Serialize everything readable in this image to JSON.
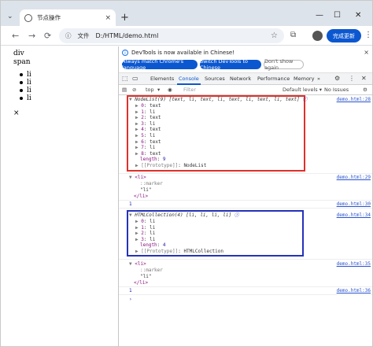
{
  "browser": {
    "tab_title": "节点操作",
    "tab_close": "×",
    "new_tab": "+",
    "tab_menu": "⌄",
    "win_min": "—",
    "win_max": "☐",
    "win_close": "✕",
    "back": "←",
    "forward": "→",
    "reload": "⟳",
    "site_info": "ⓘ",
    "file_chip": "文件",
    "url": "D:/HTML/demo.html",
    "star": "☆",
    "ext": "⧉",
    "avatar": "●",
    "finish_update": "完成更新",
    "kebab": "⋮"
  },
  "page": {
    "div_text": "div",
    "span_text": "span",
    "items": [
      "li",
      "li",
      "li",
      "li"
    ],
    "x_text": "×"
  },
  "devtools": {
    "info_message": "DevTools is now available in Chinese!",
    "btn_match": "Always match Chrome's language",
    "btn_switch": "Switch DevTools to Chinese",
    "btn_dont": "Don't show again",
    "info_close": "×",
    "tabs": [
      "Elements",
      "Console",
      "Sources",
      "Network",
      "Performance",
      "Memory"
    ],
    "more_tabs": "»",
    "top_context": "top",
    "filter_placeholder": "Filter",
    "default_levels": "Default levels ▾",
    "no_issues": "No Issues",
    "accent": "#0b57d0",
    "red_box": "#e0302b",
    "blue_box": "#2432b8"
  },
  "console": {
    "nodelist": {
      "header": "NodeList(9) [text, li, text, li, text, li, text, li, text]",
      "source": "demo.html:28",
      "entries": [
        {
          "idx": "0",
          "val": "text"
        },
        {
          "idx": "1",
          "val": "li"
        },
        {
          "idx": "2",
          "val": "text"
        },
        {
          "idx": "3",
          "val": "li"
        },
        {
          "idx": "4",
          "val": "text"
        },
        {
          "idx": "5",
          "val": "li"
        },
        {
          "idx": "6",
          "val": "text"
        },
        {
          "idx": "7",
          "val": "li"
        },
        {
          "idx": "8",
          "val": "text"
        }
      ],
      "length_label": "length",
      "length_val": "9",
      "proto_label": "[[Prototype]]",
      "proto_val": "NodeList"
    },
    "li1": {
      "open": "<li>",
      "marker": "::marker",
      "text": "\"li\"",
      "close": "</li>",
      "source": "demo.html:29"
    },
    "one1": {
      "value": "1",
      "source": "demo.html:30"
    },
    "collection": {
      "header": "HTMLCollection(4) [li, li, li, li]",
      "source": "demo.html:34",
      "entries": [
        {
          "idx": "0",
          "val": "li"
        },
        {
          "idx": "1",
          "val": "li"
        },
        {
          "idx": "2",
          "val": "li"
        },
        {
          "idx": "3",
          "val": "li"
        }
      ],
      "length_label": "length",
      "length_val": "4",
      "proto_label": "[[Prototype]]",
      "proto_val": "HTMLCollection"
    },
    "li2": {
      "open": "<li>",
      "marker": "::marker",
      "text": "\"li\"",
      "close": "</li>",
      "source": "demo.html:35"
    },
    "one2": {
      "value": "1",
      "source": "demo.html:36"
    },
    "prompt": "›"
  }
}
